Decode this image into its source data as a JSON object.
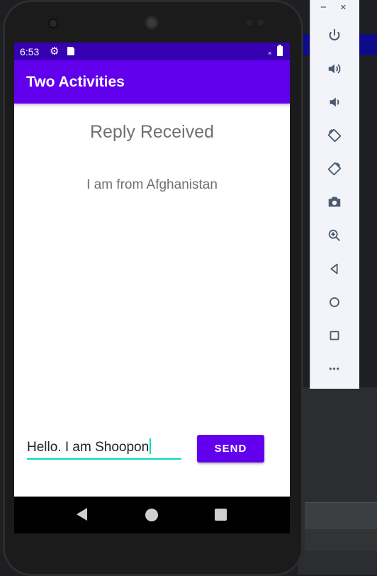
{
  "status_bar": {
    "time": "6:53"
  },
  "app_bar": {
    "title": "Two Activities"
  },
  "main": {
    "reply_header": "Reply Received",
    "reply_text": "I am from Afghanistan"
  },
  "composer": {
    "message_value": "Hello. I am Shoopon",
    "send_label": "SEND"
  },
  "emulator_toolbar": {
    "minimize_glyph": "−",
    "close_glyph": "×",
    "more_glyph": "•••",
    "buttons": [
      "power-icon",
      "volume-up-icon",
      "volume-down-icon",
      "rotate-left-icon",
      "rotate-right-icon",
      "camera-icon",
      "zoom-icon",
      "back-icon",
      "home-icon",
      "overview-icon",
      "more-icon"
    ]
  },
  "colors": {
    "status_bar": "#3700b3",
    "app_bar": "#6200ee",
    "accent": "#03dac5",
    "button": "#6200ee"
  }
}
